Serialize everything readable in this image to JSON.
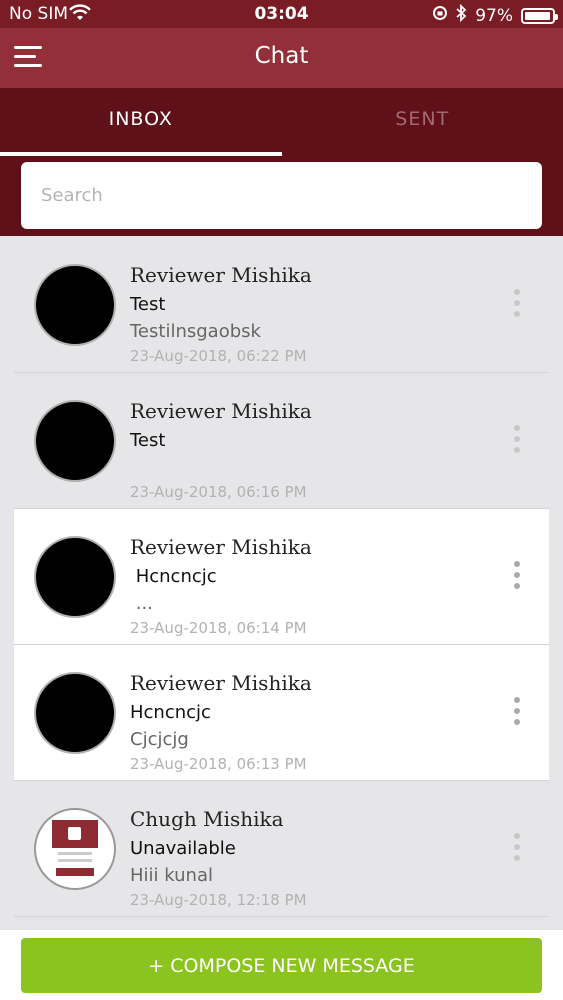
{
  "status_bar": {
    "carrier": "No SIM",
    "time": "03:04",
    "battery": "97%",
    "icons": [
      "wifi-icon",
      "rotation-lock-icon",
      "bluetooth-icon",
      "battery-icon"
    ]
  },
  "app_bar": {
    "title": "Chat",
    "menu_icon": "hamburger-menu-icon"
  },
  "tabs": [
    {
      "label": "INBOX",
      "active": true
    },
    {
      "label": "SENT",
      "active": false
    }
  ],
  "search": {
    "placeholder": "Search",
    "value": ""
  },
  "messages": [
    {
      "sender": "Reviewer Mishika",
      "subject": "Test",
      "preview": "Testilnsgaobsk",
      "timestamp": "23-Aug-2018, 06:22 PM",
      "unread": false,
      "avatar": "black"
    },
    {
      "sender": "Reviewer Mishika",
      "subject": "Test",
      "preview": "",
      "timestamp": "23-Aug-2018, 06:16 PM",
      "unread": false,
      "avatar": "black"
    },
    {
      "sender": "Reviewer Mishika",
      "subject": " Hcncncjc",
      "preview": " ...",
      "timestamp": "23-Aug-2018, 06:14 PM",
      "unread": true,
      "avatar": "black"
    },
    {
      "sender": "Reviewer Mishika",
      "subject": "Hcncncjc",
      "preview": "Cjcjcjg",
      "timestamp": "23-Aug-2018, 06:13 PM",
      "unread": true,
      "avatar": "black"
    },
    {
      "sender": "Chugh Mishika",
      "subject": "Unavailable",
      "preview": "Hiii kunal",
      "timestamp": "23-Aug-2018, 12:18 PM",
      "unread": false,
      "avatar": "image"
    }
  ],
  "compose": {
    "label": "+ COMPOSE NEW MESSAGE"
  },
  "colors": {
    "status_bar": "#7a1c24",
    "app_bar": "#922f38",
    "tab_bar": "#5f1018",
    "compose_button": "#8cc41f",
    "list_background": "#e6e6e8"
  }
}
